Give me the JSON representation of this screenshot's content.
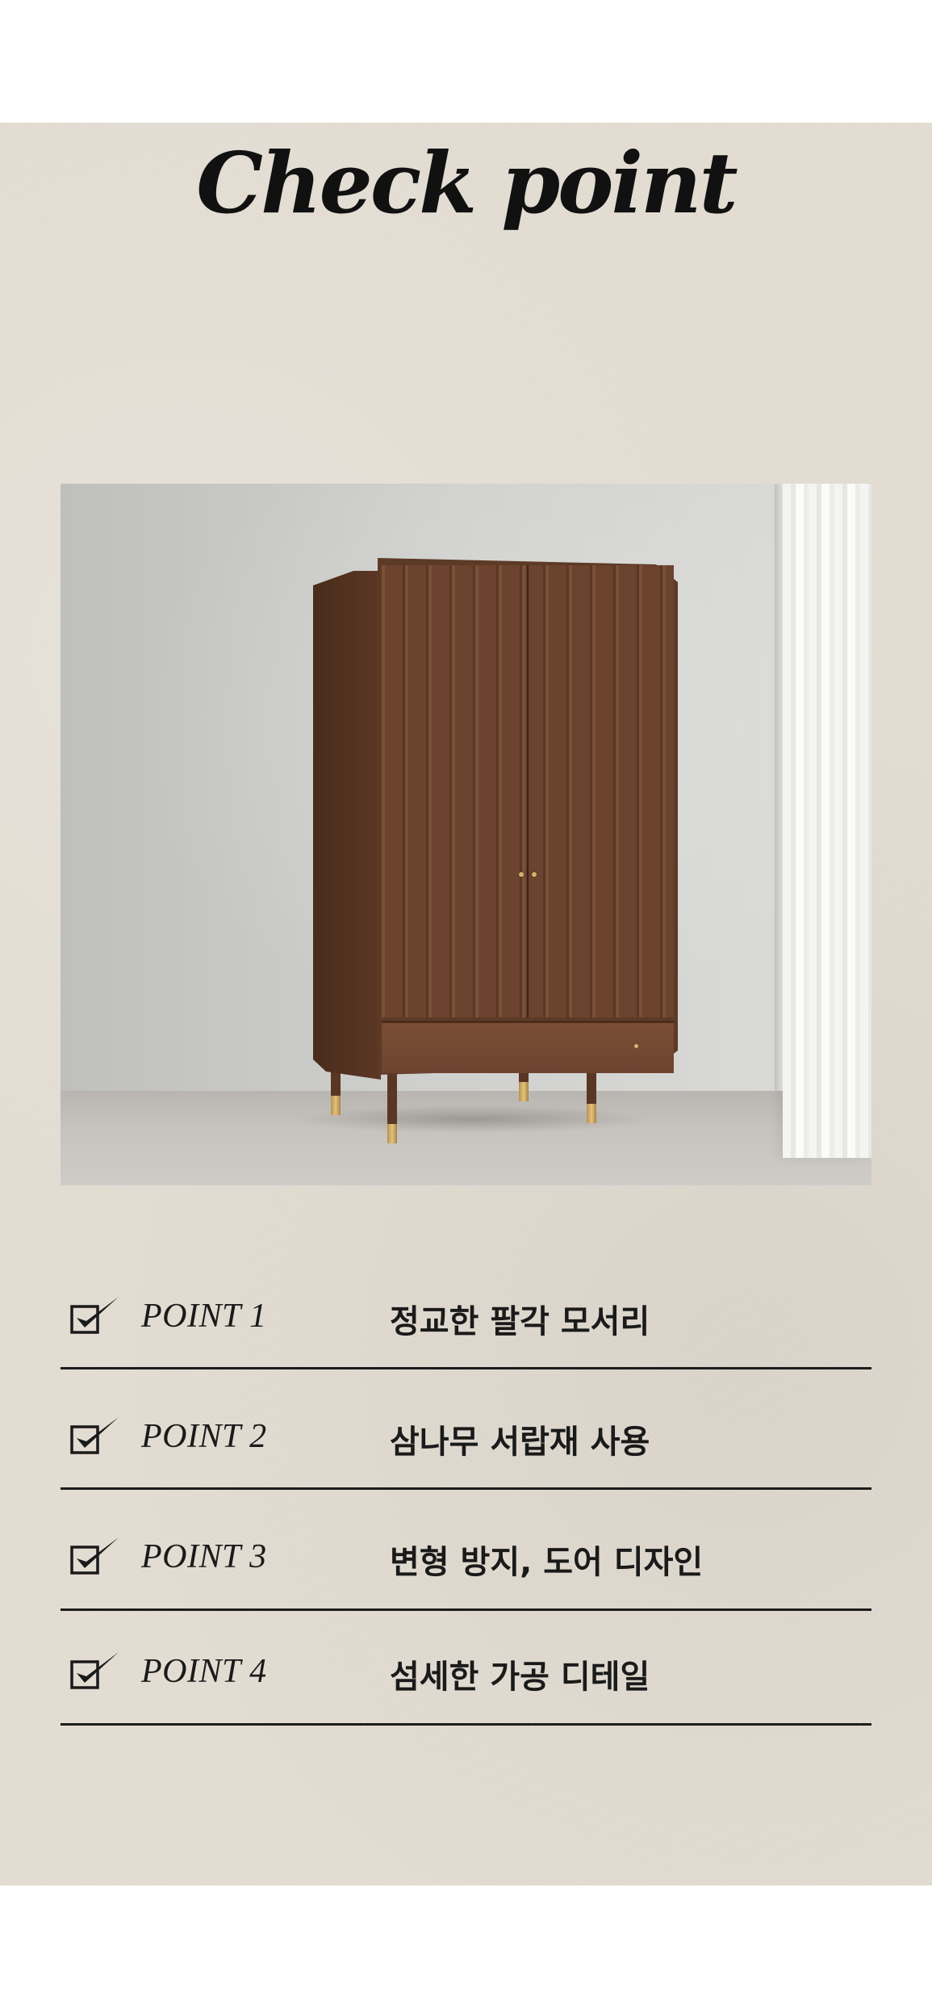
{
  "title": "Check point",
  "photo": {
    "subject": "wardrobe-photo"
  },
  "points": [
    {
      "label": "POINT 1",
      "description": "정교한 팔각 모서리"
    },
    {
      "label": "POINT 2",
      "description": "삼나무 서랍재 사용"
    },
    {
      "label": "POINT 3",
      "description": "변형 방지, 도어 디자인"
    },
    {
      "label": "POINT 4",
      "description": "섬세한 가공 디테일"
    }
  ],
  "colors": {
    "background": "#e3ddd2",
    "text": "#111111",
    "wood": "#5d3a26",
    "brass": "#d6b36a"
  },
  "icons": {
    "check": "checkbox-check-icon"
  }
}
